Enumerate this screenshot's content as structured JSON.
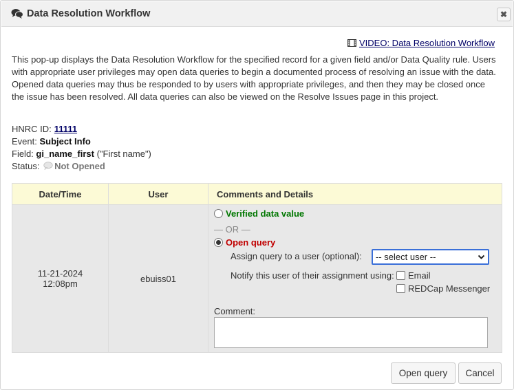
{
  "dialog": {
    "title": "Data Resolution Workflow",
    "close_label": "✖",
    "title_icon": "comments-icon"
  },
  "video_link": {
    "label": "VIDEO: Data Resolution Workflow",
    "icon": "film-icon"
  },
  "intro_text": "This pop-up displays the Data Resolution Workflow for the specified record for a given field and/or Data Quality rule. Users with appropriate user privileges may open data queries to begin a documented process of resolving an issue with the data. Opened data queries may thus be responded to by users with appropriate privileges, and then they may be closed once the issue has been resolved. All data queries can also be viewed on the Resolve Issues page in this project.",
  "meta": {
    "record_label": "HNRC ID:",
    "record_id": "11111",
    "event_label": "Event:",
    "event_value": "Subject Info",
    "field_label": "Field:",
    "field_name": "gi_name_first",
    "field_desc": "(\"First name\")",
    "status_label": "Status:",
    "status_value": "Not Opened"
  },
  "table": {
    "headers": [
      "Date/Time",
      "User",
      "Comments and Details"
    ],
    "row": {
      "date": "11-21-2024",
      "time": "12:08pm",
      "user": "ebuiss01"
    }
  },
  "details": {
    "verified_label": "Verified data value",
    "or_label": "— OR —",
    "open_query_label": "Open query",
    "open_query_selected": true,
    "assign_label": "Assign query to a user (optional):",
    "assign_select_value": "-- select user --",
    "notify_label": "Notify this user of their assignment using:",
    "notify_email_label": "Email",
    "notify_messenger_label": "REDCap Messenger",
    "comment_label": "Comment:",
    "comment_value": ""
  },
  "buttons": {
    "open_query": "Open query",
    "cancel": "Cancel"
  },
  "colors": {
    "header_bg": "#fcfad6",
    "cell_bg": "#e8e8e8",
    "verified": "#007700",
    "open_query": "#c00000",
    "link": "#000066"
  }
}
